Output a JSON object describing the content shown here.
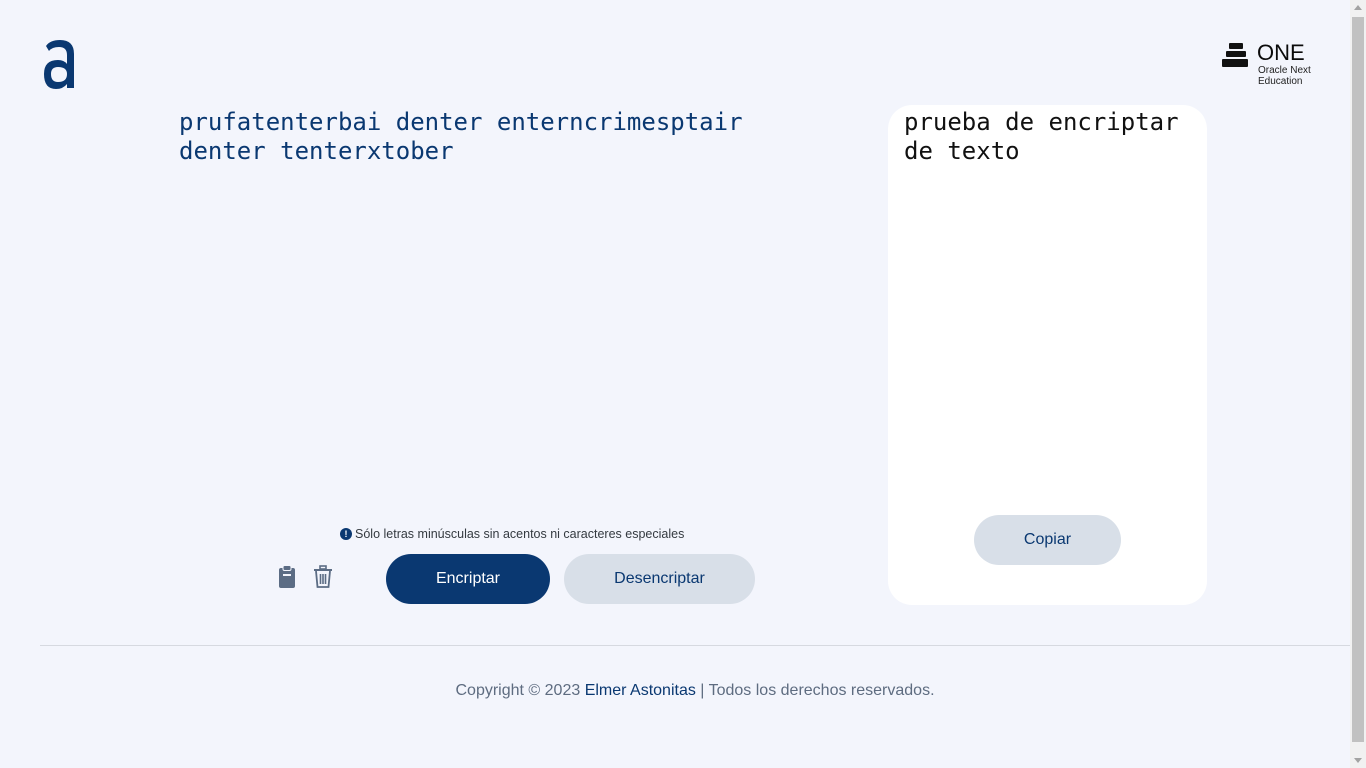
{
  "header": {
    "logo_alura_icon": "alura-a-logo",
    "logo_one": {
      "icon": "one-stack-icon",
      "title": "ONE",
      "subtitle_line1": "Oracle Next",
      "subtitle_line2": "Education"
    }
  },
  "input": {
    "value": "prufatenterbai denter enterncrimesptair denter tenterxtober"
  },
  "hint": {
    "icon": "exclamation-circle-icon",
    "text": "Sólo letras minúsculas sin acentos ni caracteres especiales"
  },
  "actions": {
    "paste_icon": "clipboard-icon",
    "clear_icon": "trash-icon",
    "encrypt_label": "Encriptar",
    "decrypt_label": "Desencriptar"
  },
  "output": {
    "text": "prueba de encriptar de texto",
    "copy_label": "Copiar"
  },
  "footer": {
    "prefix": "Copyright © 2023 ",
    "author": "Elmer Astonitas",
    "separator": " | ",
    "suffix": "Todos los derechos reservados."
  },
  "colors": {
    "primary": "#0a3871",
    "background": "#f3f5fc",
    "secondary_button": "#d8dfe8"
  }
}
